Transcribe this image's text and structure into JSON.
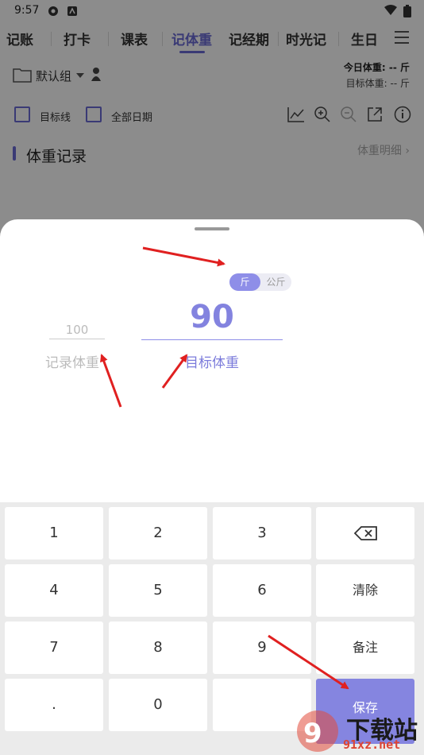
{
  "status_bar": {
    "time": "9:57"
  },
  "tabs": [
    {
      "label": "记账"
    },
    {
      "label": "打卡"
    },
    {
      "label": "课表"
    },
    {
      "label": "记体重"
    },
    {
      "label": "记经期"
    },
    {
      "label": "时光记"
    },
    {
      "label": "生日"
    }
  ],
  "toolbar": {
    "group_label": "默认组",
    "today_weight": "今日体重: -- 斤",
    "target_weight": "目标体重: -- 斤",
    "checkbox_target_line": "目标线",
    "checkbox_all_dates": "全部日期"
  },
  "section": {
    "title": "体重记录",
    "detail_link": "体重明细 ›"
  },
  "sheet": {
    "unit_jin": "斤",
    "unit_kg": "公斤",
    "record_value": "100",
    "record_label": "记录体重",
    "target_value": "90",
    "target_label": "目标体重"
  },
  "keypad": {
    "k1": "1",
    "k2": "2",
    "k3": "3",
    "k4": "4",
    "k5": "5",
    "k6": "6",
    "k7": "7",
    "k8": "8",
    "k9": "9",
    "kdot": ".",
    "k0": "0",
    "clear": "清除",
    "note": "备注",
    "save": "保存"
  },
  "watermark": {
    "title": "下载站",
    "url": "91xz.net"
  },
  "colors": {
    "accent": "#8383df",
    "arrow": "#e02020"
  }
}
